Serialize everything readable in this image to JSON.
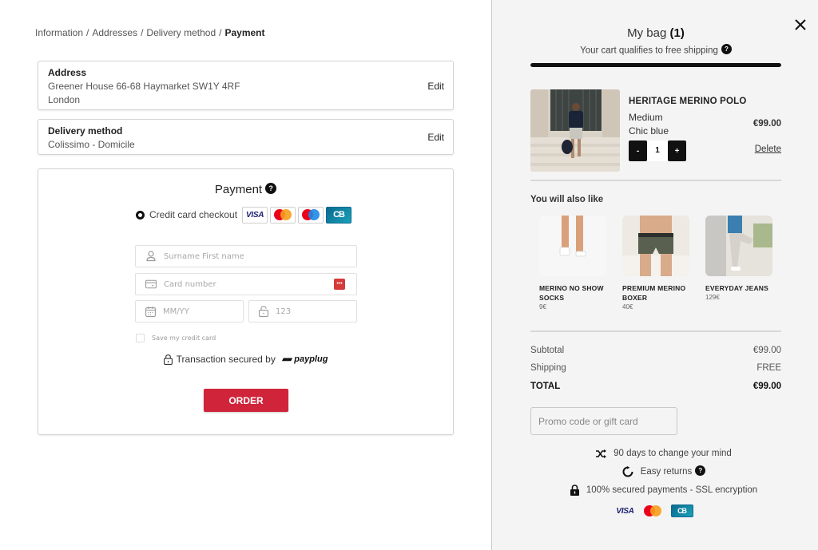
{
  "breadcrumb": {
    "items": [
      "Information",
      "Addresses",
      "Delivery method"
    ],
    "separator": "/",
    "current": "Payment"
  },
  "address": {
    "title": "Address",
    "line1": "Greener House 66-68 Haymarket SW1Y 4RF",
    "line2": "London",
    "edit_label": "Edit"
  },
  "delivery": {
    "title": "Delivery method",
    "line1": "Colissimo - Domicile",
    "edit_label": "Edit"
  },
  "payment": {
    "title": "Payment",
    "help_icon": "?",
    "method_label": "Credit card checkout",
    "card_brands": [
      "VISA",
      "Mastercard",
      "Maestro",
      "CB"
    ],
    "cb_label": "CB",
    "visa_label": "VISA",
    "name_placeholder": "Surname First name",
    "card_placeholder": "Card number",
    "expiry_placeholder": "MM/YY",
    "cvc_placeholder": "123",
    "save_card_label": "Save my credit card",
    "secured_label": "Transaction secured by",
    "provider": "payplug",
    "order_label": "ORDER"
  },
  "bag": {
    "title": "My bag",
    "count": "(1)",
    "free_shipping_text": "Your cart qualifies to free shipping",
    "help_icon": "?",
    "shipping_progress": 1.0,
    "item": {
      "name": "HERITAGE MERINO POLO",
      "size": "Medium",
      "color": "Chic blue",
      "quantity": "1",
      "minus_label": "-",
      "plus_label": "+",
      "price": "€99.00",
      "delete_label": "Delete"
    },
    "recommend_title": "You will also like",
    "recommendations": [
      {
        "name": "MERINO NO SHOW SOCKS",
        "price": "9€"
      },
      {
        "name": "PREMIUM MERINO BOXER",
        "price": "40€"
      },
      {
        "name": "EVERYDAY JEANS",
        "price": "129€"
      }
    ],
    "subtotal_label": "Subtotal",
    "subtotal_value": "€99.00",
    "shipping_label": "Shipping",
    "shipping_value": "FREE",
    "total_label": "TOTAL",
    "total_value": "€99.00",
    "promo_placeholder": "Promo code or gift card",
    "reassurance": [
      "90 days to change your mind",
      "Easy returns",
      "100% secured payments - SSL encryption"
    ],
    "footer_visa": "VISA",
    "footer_cb": "CB"
  },
  "colors": {
    "accent": "#d0243a",
    "panel_bg": "#f4f4f4",
    "dark": "#111111"
  }
}
